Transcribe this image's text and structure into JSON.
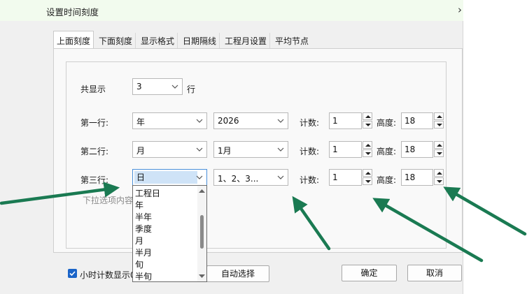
{
  "window": {
    "title": "设置时间刻度",
    "close_glyph": "›"
  },
  "tabs": [
    {
      "label": "上面刻度",
      "active": true
    },
    {
      "label": "下面刻度"
    },
    {
      "label": "显示格式"
    },
    {
      "label": "日期隔线"
    },
    {
      "label": "工程月设置"
    },
    {
      "label": "平均节点"
    }
  ],
  "rows_total": {
    "label": "共显示",
    "value": "3",
    "suffix": "行"
  },
  "rows": [
    {
      "label": "第一行:",
      "unit": "年",
      "format": "2026",
      "count_label": "计数:",
      "count": "1",
      "height_label": "高度:",
      "height": "18"
    },
    {
      "label": "第二行:",
      "unit": "月",
      "format": "1月",
      "count_label": "计数:",
      "count": "1",
      "height_label": "高度:",
      "height": "18"
    },
    {
      "label": "第三行:",
      "unit": "日",
      "format": "1、2、3...",
      "count_label": "计数:",
      "count": "1",
      "height_label": "高度:",
      "height": "18"
    }
  ],
  "dropdown_options": [
    "工程日",
    "年",
    "半年",
    "季度",
    "月",
    "半月",
    "旬",
    "半旬"
  ],
  "hint": "下拉选项内容",
  "hour_option": {
    "label": "小时计数显示0",
    "checked": true
  },
  "buttons": {
    "auto_select": "自动选择",
    "ok": "确定",
    "cancel": "取消"
  },
  "colors": {
    "arrow": "#1a7a52",
    "accent": "#1a64c8",
    "title_bg": "#f2fbee"
  }
}
